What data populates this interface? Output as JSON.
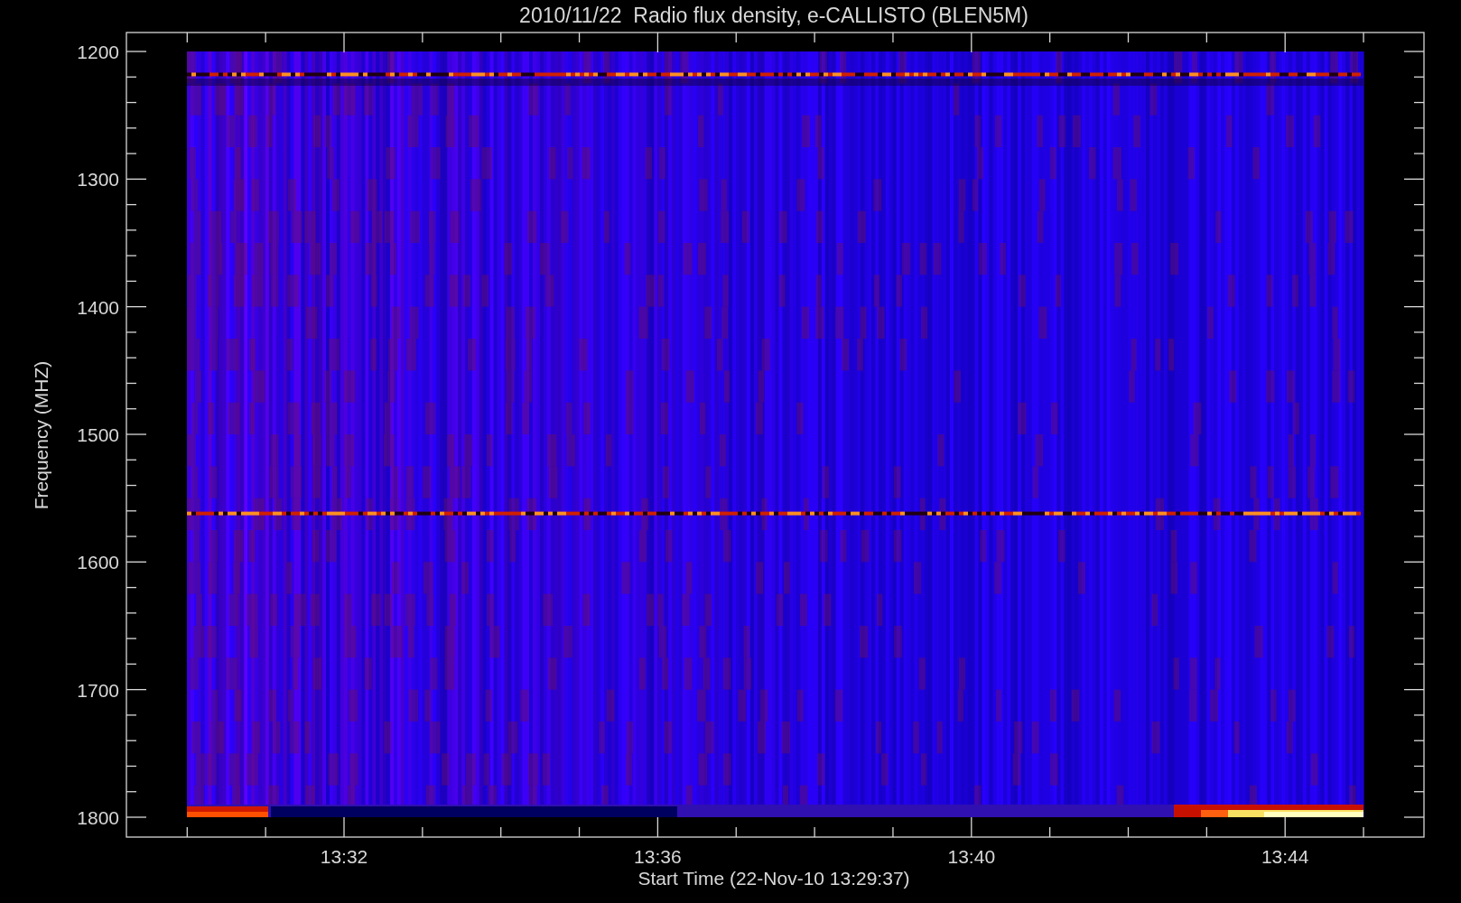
{
  "title": "2010/11/22  Radio flux density, e-CALLISTO (BLEN5M)",
  "y_axis": {
    "label": "Frequency (MHZ)",
    "ticks": [
      "1200",
      "1300",
      "1400",
      "1500",
      "1600",
      "1700",
      "1800"
    ]
  },
  "x_axis": {
    "label": "Start Time (22-Nov-10 13:29:37)",
    "ticks": [
      "13:32",
      "13:36",
      "13:40",
      "13:44"
    ]
  }
}
